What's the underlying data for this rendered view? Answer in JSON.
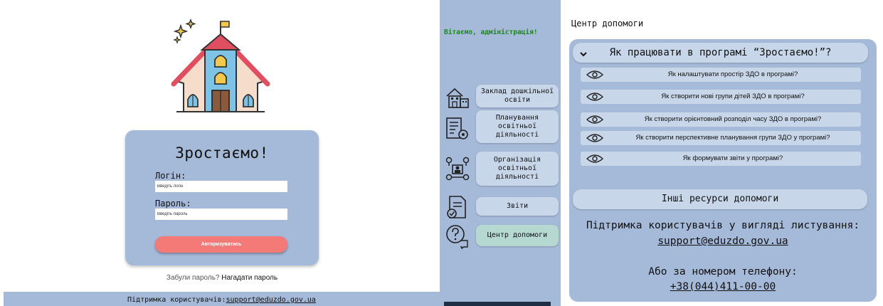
{
  "login": {
    "title": "Зростаємо!",
    "login_label": "Логін:",
    "login_placeholder": "Введіть логін",
    "password_label": "Пароль:",
    "password_placeholder": "Введіть пароль",
    "submit_label": "Авторизуватись",
    "forgot_prefix": "Забули пароль?",
    "forgot_link": "Нагадати пароль",
    "footer_prefix": "Підтримка користувачів:",
    "footer_email": "support@eduzdo.gov.ua"
  },
  "sidebar": {
    "greeting": "Вітаємо, адміністрація!",
    "items": [
      {
        "label": "Заклад дошкільної освіти",
        "icon": "building-icon"
      },
      {
        "label": "Планування освітньої діяльності",
        "icon": "planning-checklist-icon"
      },
      {
        "label": "Організація освітньої діяльності",
        "icon": "organization-network-icon"
      },
      {
        "label": "Звіти",
        "icon": "report-document-icon"
      },
      {
        "label": "Центр допомоги",
        "icon": "help-question-icon",
        "active": true
      }
    ]
  },
  "help": {
    "title": "Центр допомоги",
    "faq_header": "Як працювати в програмі “Зростаємо!”?",
    "faq_items": [
      "Як налаштувати простір ЗДО в програмі?",
      "Як створити нові групи дітей  ЗДО в програмі?",
      "Як створити орієнтовний розподіл часу  ЗДО в програмі?",
      "Як створити перспективне планування групи ЗДО у програмі?",
      "Як формувати звіти у програмі?"
    ],
    "other_resources": "Інші ресурси допомоги",
    "support_text": "Підтримка користувачів у вигляді листування:",
    "support_email": "support@eduzdo.gov.ua",
    "phone_text": "Або за номером телефону:",
    "phone_number": "+38(044)411-00-00"
  },
  "colors": {
    "panel": "#a5b9d8",
    "button": "#c7d6e9",
    "accent_red": "#f47a78",
    "greeting_green": "#1b8a1b",
    "active_nav": "#b5d8d0"
  }
}
